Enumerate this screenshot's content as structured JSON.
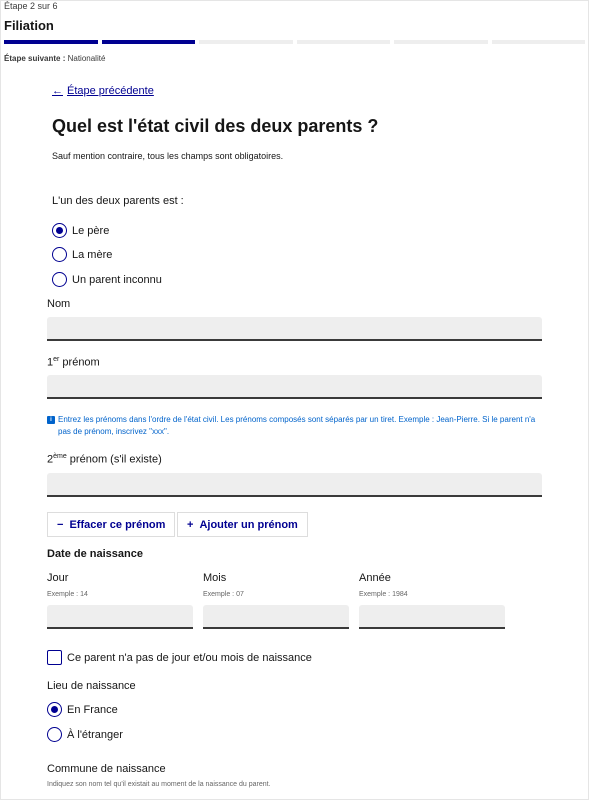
{
  "header": {
    "step_label": "Étape 2 sur 6",
    "step_title": "Filiation",
    "progress_total": 6,
    "progress_done": 2,
    "next_step_prefix": "Étape suivante :",
    "next_step_value": "Nationalité"
  },
  "nav": {
    "back_arrow": "←",
    "back_label": "Étape précédente"
  },
  "page": {
    "title": "Quel est l'état civil des deux parents ?",
    "mandatory_note": "Sauf mention contraire, tous les champs sont obligatoires."
  },
  "parent_type": {
    "legend": "L'un des deux parents est :",
    "options": [
      "Le père",
      "La mère",
      "Un parent inconnu"
    ],
    "selected_index": 0
  },
  "nom": {
    "label": "Nom",
    "value": ""
  },
  "prenom1": {
    "label_sup": "er",
    "label_num": "1",
    "label_rest": " prénom",
    "value": ""
  },
  "info": {
    "icon": "i",
    "text": "Entrez les prénoms dans l'ordre de l'état civil. Les prénoms composés sont séparés par un tiret. Exemple : Jean-Pierre. Si le parent n'a pas de prénom, inscrivez \"xxx\"."
  },
  "prenom2": {
    "label_num": "2",
    "label_sup": "ème",
    "label_rest": " prénom (s'il existe)",
    "value": ""
  },
  "buttons": {
    "remove_icon": "−",
    "remove_label": "Effacer ce prénom",
    "add_icon": "+",
    "add_label": "Ajouter un prénom"
  },
  "birth_date": {
    "title": "Date de naissance",
    "day_label": "Jour",
    "day_hint": "Exemple : 14",
    "month_label": "Mois",
    "month_hint": "Exemple : 07",
    "year_label": "Année",
    "year_hint": "Exemple : 1984"
  },
  "unknown_date_checkbox": {
    "label": "Ce parent n'a pas de jour et/ou mois de naissance",
    "checked": false
  },
  "birth_place": {
    "legend": "Lieu de naissance",
    "options": [
      "En France",
      "À l'étranger"
    ],
    "selected_index": 0
  },
  "commune": {
    "label": "Commune de naissance",
    "hint": "Indiquez son nom tel qu'il existait au moment de la naissance du parent."
  },
  "colors": {
    "primary": "#000091",
    "info": "#0063cb",
    "input_bg": "#eeeeee"
  }
}
